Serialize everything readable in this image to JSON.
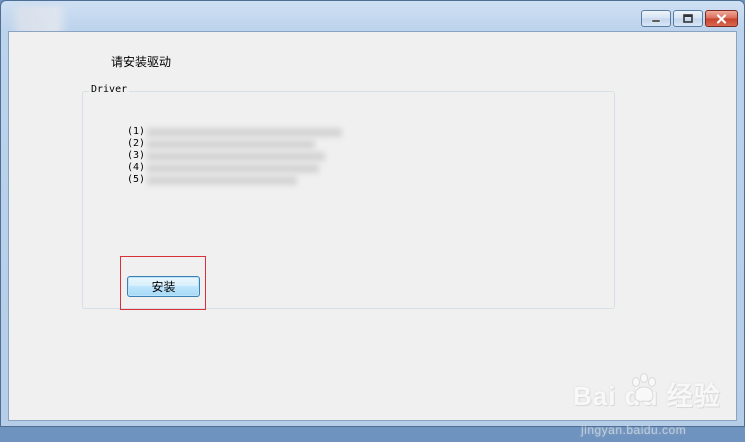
{
  "window": {
    "title": "",
    "buttons": {
      "minimize": "minimize-icon",
      "maximize": "maximize-icon",
      "close": "close-icon"
    },
    "colors": {
      "titlebar": "#bcd3ec",
      "client": "#f0f0f0",
      "close": "#c7432c",
      "highlight_frame": "#d9303a"
    }
  },
  "main": {
    "prompt": "请安装驱动",
    "group": {
      "label": "Driver",
      "items": [
        {
          "num": "(1)"
        },
        {
          "num": "(2)"
        },
        {
          "num": "(3)"
        },
        {
          "num": "(4)"
        },
        {
          "num": "(5)"
        }
      ]
    },
    "install_button": "安装"
  },
  "watermark": {
    "logo_text": "Bai du 经验",
    "site": "jingyan.baidu.com"
  }
}
